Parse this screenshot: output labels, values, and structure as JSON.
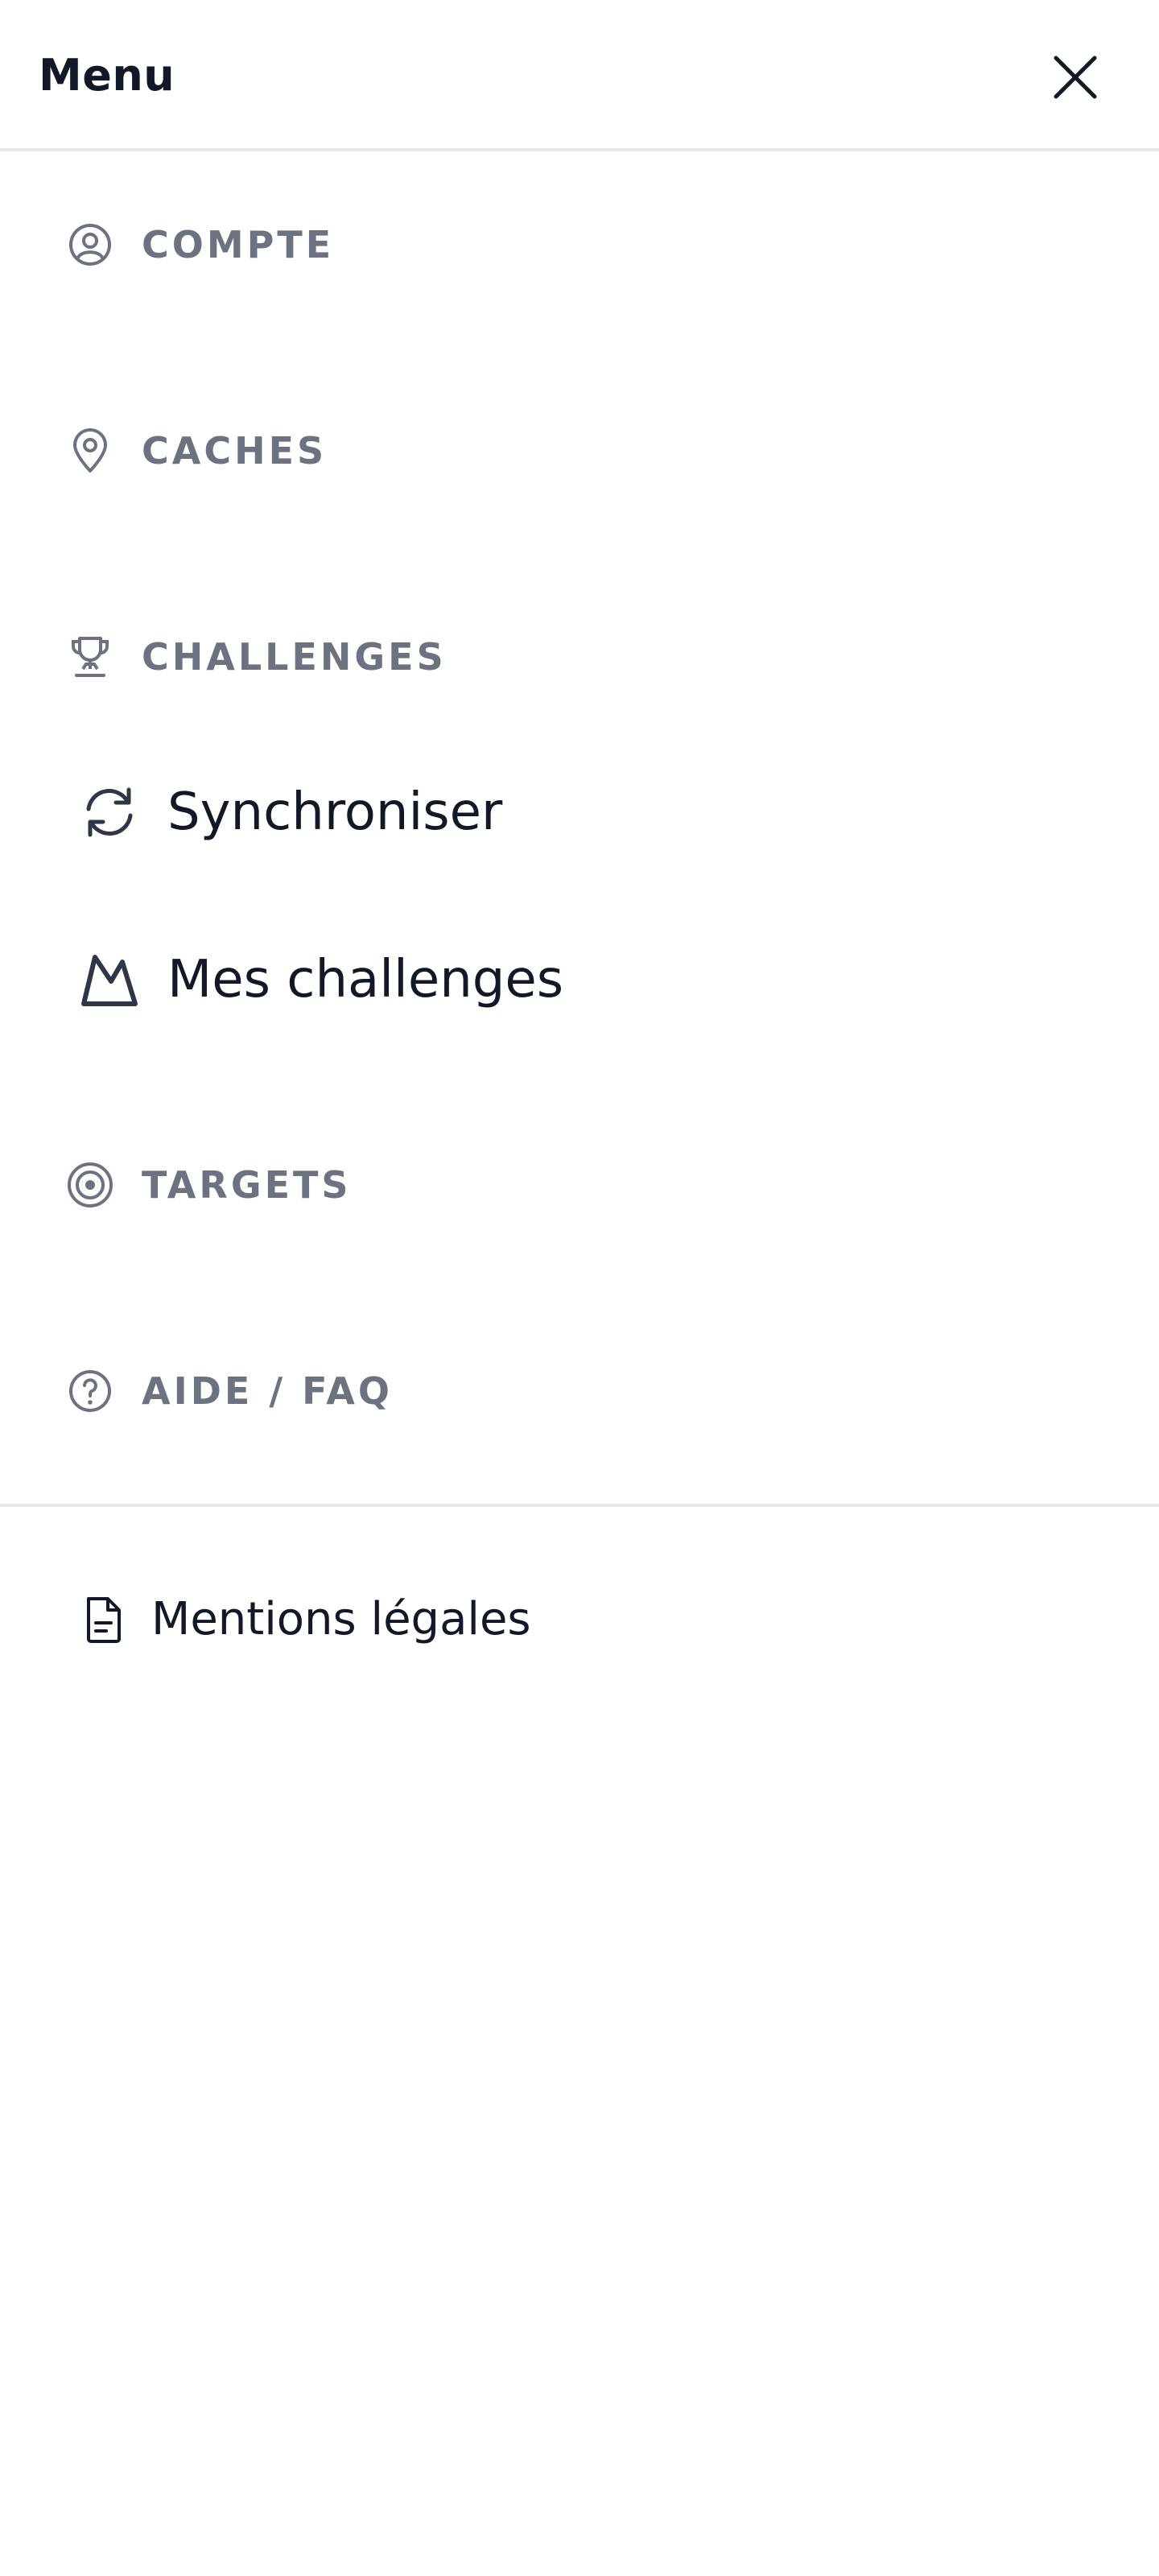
{
  "header": {
    "title": "Menu"
  },
  "sections": {
    "account": {
      "label": "COMPTE",
      "icon": "user-circle-icon"
    },
    "caches": {
      "label": "CACHES",
      "icon": "map-pin-icon"
    },
    "challenges": {
      "label": "CHALLENGES",
      "icon": "trophy-icon",
      "items": [
        {
          "label": "Synchroniser",
          "icon": "refresh-icon"
        },
        {
          "label": "Mes challenges",
          "icon": "mountain-icon"
        }
      ]
    },
    "targets": {
      "label": "TARGETS",
      "icon": "target-icon"
    },
    "help": {
      "label": "AIDE / FAQ",
      "icon": "question-circle-icon"
    }
  },
  "footer": {
    "legal_label": "Mentions légales",
    "legal_icon": "document-icon"
  },
  "colors": {
    "section_label": "#6b7280",
    "text_primary": "#111827",
    "icon_dark": "#2d3748",
    "divider": "#e5e7eb"
  }
}
